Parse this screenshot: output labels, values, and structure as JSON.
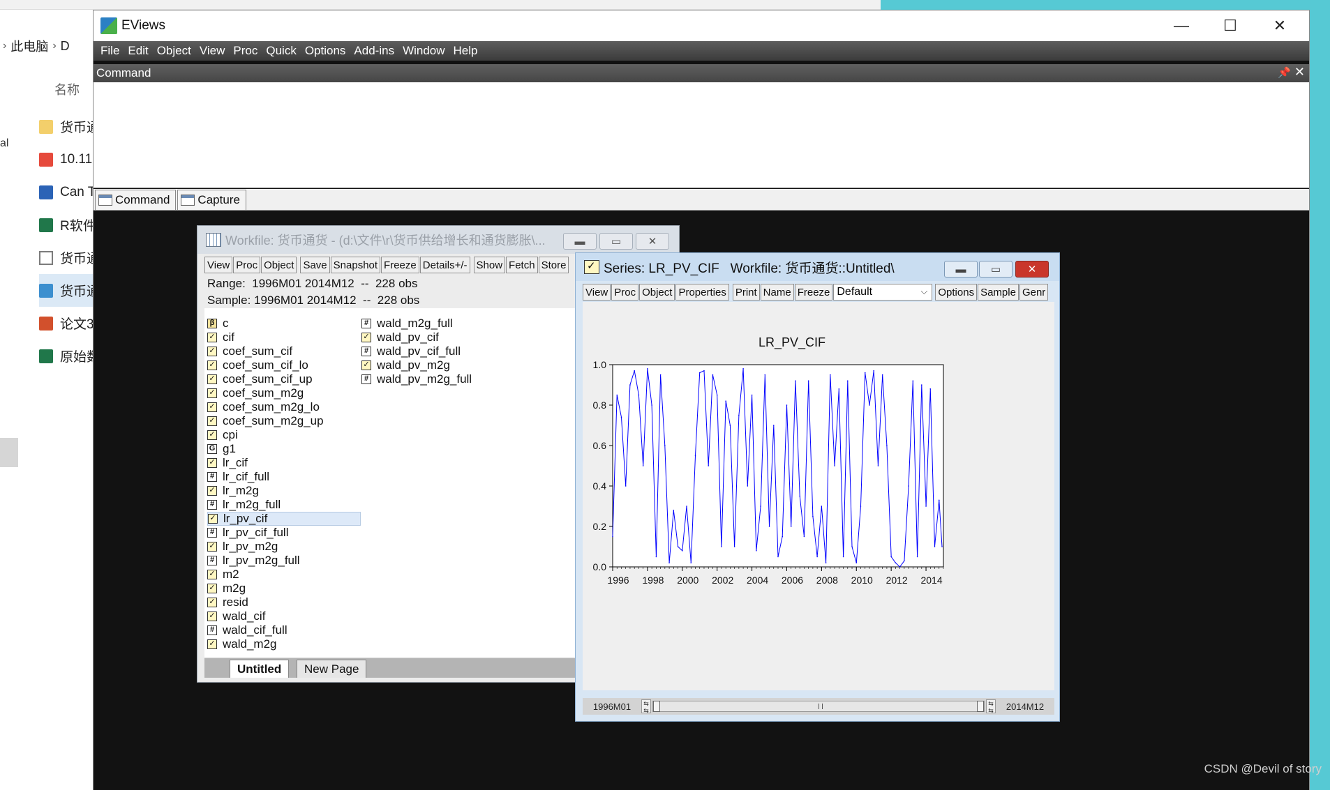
{
  "explorer": {
    "nav": [
      "此电脑",
      "D"
    ],
    "header": "名称",
    "left_fragment": "al",
    "files": [
      {
        "name": "货币通",
        "icon": "folder-icon"
      },
      {
        "name": "10.11",
        "icon": "pdf-icon"
      },
      {
        "name": "Can T",
        "icon": "word-doc-icon"
      },
      {
        "name": "R软件",
        "icon": "excel-icon"
      },
      {
        "name": "货币通",
        "icon": "text-file-icon"
      },
      {
        "name": "货币通",
        "icon": "eviews-workfile-icon",
        "selected": true
      },
      {
        "name": "论文3",
        "icon": "ppt-icon"
      },
      {
        "name": "原始数",
        "icon": "excel-icon"
      }
    ]
  },
  "eviews": {
    "title": "EViews",
    "window_controls": {
      "minimize": "—",
      "maximize": "☐",
      "close": "✕"
    },
    "menu": [
      "File",
      "Edit",
      "Object",
      "View",
      "Proc",
      "Quick",
      "Options",
      "Add-ins",
      "Window",
      "Help"
    ],
    "command_header": "Command",
    "command_tabs": [
      "Command",
      "Capture"
    ]
  },
  "workfile": {
    "title": "Workfile: 货币通货 - (d:\\文件\\r\\货币供给增长和通货膨胀\\...",
    "toolbar": [
      "View",
      "Proc",
      "Object",
      "Save",
      "Snapshot",
      "Freeze",
      "Details+/-",
      "Show",
      "Fetch",
      "Store"
    ],
    "range_line": "Range:  1996M01 2014M12  --  228 obs",
    "sample_line": "Sample: 1996M01 2014M12  --  228 obs",
    "objects_col1": [
      {
        "name": "c",
        "type": "coef"
      },
      {
        "name": "cif",
        "type": "series"
      },
      {
        "name": "coef_sum_cif",
        "type": "series"
      },
      {
        "name": "coef_sum_cif_lo",
        "type": "series"
      },
      {
        "name": "coef_sum_cif_up",
        "type": "series"
      },
      {
        "name": "coef_sum_m2g",
        "type": "series"
      },
      {
        "name": "coef_sum_m2g_lo",
        "type": "series"
      },
      {
        "name": "coef_sum_m2g_up",
        "type": "series"
      },
      {
        "name": "cpi",
        "type": "series"
      },
      {
        "name": "g1",
        "type": "group"
      },
      {
        "name": "lr_cif",
        "type": "series"
      },
      {
        "name": "lr_cif_full",
        "type": "matrix"
      },
      {
        "name": "lr_m2g",
        "type": "series"
      },
      {
        "name": "lr_m2g_full",
        "type": "matrix"
      },
      {
        "name": "lr_pv_cif",
        "type": "series",
        "selected": true
      },
      {
        "name": "lr_pv_cif_full",
        "type": "matrix"
      },
      {
        "name": "lr_pv_m2g",
        "type": "series"
      },
      {
        "name": "lr_pv_m2g_full",
        "type": "matrix"
      },
      {
        "name": "m2",
        "type": "series"
      },
      {
        "name": "m2g",
        "type": "series"
      },
      {
        "name": "resid",
        "type": "series"
      },
      {
        "name": "wald_cif",
        "type": "series"
      },
      {
        "name": "wald_cif_full",
        "type": "matrix"
      },
      {
        "name": "wald_m2g",
        "type": "series"
      }
    ],
    "objects_col2": [
      {
        "name": "wald_m2g_full",
        "type": "matrix"
      },
      {
        "name": "wald_pv_cif",
        "type": "series"
      },
      {
        "name": "wald_pv_cif_full",
        "type": "matrix"
      },
      {
        "name": "wald_pv_m2g",
        "type": "series"
      },
      {
        "name": "wald_pv_m2g_full",
        "type": "matrix"
      }
    ],
    "page_tabs": [
      "Untitled",
      "New Page"
    ]
  },
  "series_window": {
    "title": "Series: LR_PV_CIF   Workfile: 货币通货::Untitled\\",
    "toolbar_left": [
      "View",
      "Proc",
      "Object",
      "Properties"
    ],
    "toolbar_mid": [
      "Print",
      "Name",
      "Freeze"
    ],
    "dropdown_value": "Default",
    "toolbar_right": [
      "Options",
      "Sample",
      "Genr"
    ],
    "sample_start": "1996M01",
    "sample_end": "2014M12",
    "line_color": "#0000ff"
  },
  "chart_data": {
    "type": "line",
    "title": "LR_PV_CIF",
    "xlabel": "",
    "ylabel": "",
    "ylim": [
      0,
      1
    ],
    "xlim": [
      1996,
      2015
    ],
    "yticks": [
      "0.0",
      "0.2",
      "0.4",
      "0.6",
      "0.8",
      "1.0"
    ],
    "xticks": [
      "1996",
      "1998",
      "2000",
      "2002",
      "2004",
      "2006",
      "2008",
      "2010",
      "2012",
      "2014"
    ],
    "grid": false,
    "x": [
      1996.0,
      1996.25,
      1996.5,
      1996.75,
      1997.0,
      1997.25,
      1997.5,
      1997.75,
      1998.0,
      1998.25,
      1998.5,
      1998.75,
      1999.0,
      1999.25,
      1999.5,
      1999.75,
      2000.0,
      2000.25,
      2000.5,
      2000.75,
      2001.0,
      2001.25,
      2001.5,
      2001.75,
      2002.0,
      2002.25,
      2002.5,
      2002.75,
      2003.0,
      2003.25,
      2003.5,
      2003.75,
      2004.0,
      2004.25,
      2004.5,
      2004.75,
      2005.0,
      2005.25,
      2005.5,
      2005.75,
      2006.0,
      2006.25,
      2006.5,
      2006.75,
      2007.0,
      2007.25,
      2007.5,
      2007.75,
      2008.0,
      2008.25,
      2008.5,
      2008.75,
      2009.0,
      2009.25,
      2009.5,
      2009.75,
      2010.0,
      2010.25,
      2010.5,
      2010.75,
      2011.0,
      2011.25,
      2011.5,
      2011.75,
      2012.0,
      2012.25,
      2012.5,
      2012.75,
      2013.0,
      2013.25,
      2013.5,
      2013.75,
      2014.0,
      2014.25,
      2014.5,
      2014.75,
      2014.92
    ],
    "values": [
      0.15,
      0.85,
      0.74,
      0.4,
      0.9,
      0.97,
      0.85,
      0.5,
      0.98,
      0.8,
      0.05,
      0.95,
      0.6,
      0.02,
      0.28,
      0.1,
      0.08,
      0.3,
      0.02,
      0.55,
      0.96,
      0.97,
      0.5,
      0.95,
      0.85,
      0.1,
      0.82,
      0.7,
      0.1,
      0.75,
      0.98,
      0.4,
      0.85,
      0.08,
      0.3,
      0.95,
      0.2,
      0.7,
      0.05,
      0.15,
      0.8,
      0.2,
      0.92,
      0.35,
      0.15,
      0.92,
      0.25,
      0.05,
      0.3,
      0.02,
      0.95,
      0.5,
      0.88,
      0.05,
      0.92,
      0.1,
      0.02,
      0.3,
      0.96,
      0.8,
      0.97,
      0.5,
      0.95,
      0.6,
      0.05,
      0.02,
      0.0,
      0.03,
      0.4,
      0.92,
      0.05,
      0.9,
      0.3,
      0.88,
      0.1,
      0.33,
      0.1
    ]
  }
}
